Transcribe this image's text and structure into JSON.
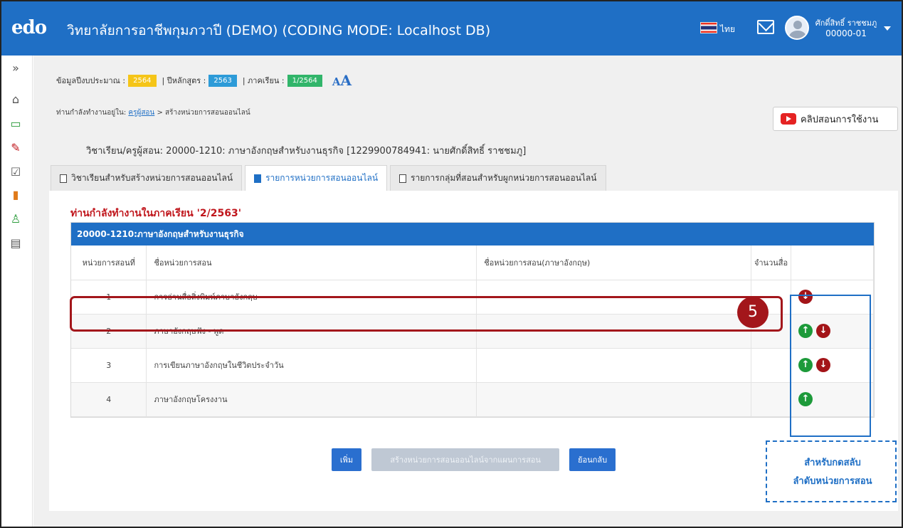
{
  "header": {
    "logo_text": "edo",
    "title": "วิทยาลัยการอาชีพกุมภวาปี (DEMO) (CODING MODE: Localhost DB)",
    "language": "ไทย",
    "user_name": "ศักดิ์สิทธิ์ ราชชมภู",
    "user_id": "00000-01"
  },
  "sidebar": {
    "icons": [
      "expand-icon",
      "home-icon",
      "monitor-icon",
      "pencil-icon",
      "checklist-icon",
      "books-icon",
      "user-icon",
      "archive-icon"
    ],
    "glyphs": [
      "»",
      "⌂",
      "▭",
      "✎",
      "☑",
      "▮",
      "♙",
      "▤"
    ]
  },
  "status_bar": {
    "budget_label": "ข้อมูลปีงบประมาณ :",
    "budget_value": "2564",
    "curriculum_label": "| ปีหลักสูตร :",
    "curriculum_value": "2563",
    "semester_label": "| ภาคเรียน :",
    "semester_value": "1/2564",
    "font_size_small": "A",
    "font_size_large": "A"
  },
  "breadcrumb": {
    "prefix": "ท่านกำลังทำงานอยู่ใน:",
    "link": "ครูผู้สอน",
    "current": " > สร้างหน่วยการสอนออนไลน์"
  },
  "help_button": "คลิปสอนการใช้งาน",
  "course_info": "วิชาเรียน/ครูผู้สอน: 20000-1210: ภาษาอังกฤษสำหรับงานธุรกิจ [1229900784941: นายศักดิ์สิทธิ์ ราชชมภู]",
  "tabs": [
    {
      "label": "วิชาเรียนสำหรับสร้างหน่วยการสอนออนไลน์"
    },
    {
      "label": "รายการหน่วยการสอนออนไลน์"
    },
    {
      "label": "รายการกลุ่มที่สอนสำหรับผูกหน่วยการสอนออนไลน์"
    }
  ],
  "semester_note": "ท่านกำลังทำงานในภาคเรียน '2/2563'",
  "table": {
    "title": "20000-1210:ภาษาอังกฤษสำหรับงานธุรกิจ",
    "headers": [
      "หน่วยการสอนที่",
      "ชื่อหน่วยการสอน",
      "ชื่อหน่วยการสอน(ภาษาอังกฤษ)",
      "จำนวนสื่อ",
      ""
    ],
    "rows": [
      {
        "no": "1",
        "name": "การอ่านสื่อสิ่งพิมพ์ภาษาอังกฤษ",
        "name_en": "",
        "media": "",
        "up": false,
        "down": true
      },
      {
        "no": "2",
        "name": "ภาษาอังกฤษฟัง - พูด",
        "name_en": "",
        "media": "",
        "up": true,
        "down": true
      },
      {
        "no": "3",
        "name": "การเขียนภาษาอังกฤษในชีวิตประจำวัน",
        "name_en": "",
        "media": "",
        "up": true,
        "down": true
      },
      {
        "no": "4",
        "name": "ภาษาอังกฤษโครงงาน",
        "name_en": "",
        "media": "",
        "up": true,
        "down": false
      }
    ]
  },
  "buttons": {
    "add": "เพิ่ม",
    "create_from_plan": "สร้างหน่วยการสอนออนไลน์จากแผนการสอน",
    "back": "ย้อนกลับ"
  },
  "annotation": {
    "step": "5",
    "note_line1": "สำหรับกดสลับ",
    "note_line2": "ลำดับหน่วยการสอน"
  }
}
